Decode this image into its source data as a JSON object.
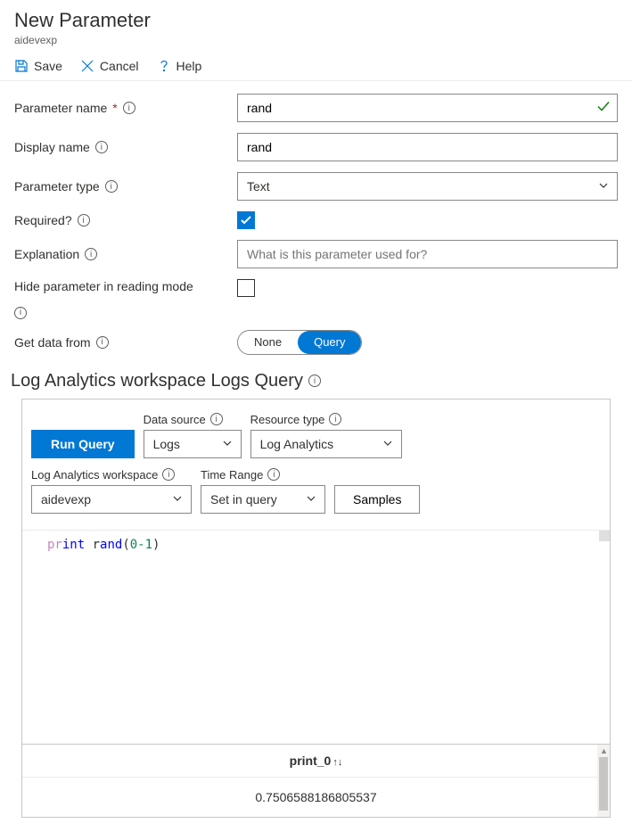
{
  "header": {
    "title": "New Parameter",
    "subtitle": "aidevexp"
  },
  "toolbar": {
    "save": "Save",
    "cancel": "Cancel",
    "help": "Help"
  },
  "form": {
    "param_name_label": "Parameter name",
    "param_name_value": "rand",
    "display_name_label": "Display name",
    "display_name_value": "rand",
    "param_type_label": "Parameter type",
    "param_type_value": "Text",
    "required_label": "Required?",
    "required_checked": true,
    "explanation_label": "Explanation",
    "explanation_placeholder": "What is this parameter used for?",
    "hide_label": "Hide parameter in reading mode",
    "get_data_label": "Get data from",
    "seg_none": "None",
    "seg_query": "Query"
  },
  "section": {
    "title": "Log Analytics workspace Logs Query"
  },
  "query": {
    "run": "Run Query",
    "data_source_label": "Data source",
    "data_source_value": "Logs",
    "resource_type_label": "Resource type",
    "resource_type_value": "Log Analytics",
    "workspace_label": "Log Analytics workspace",
    "workspace_value": "aidevexp",
    "time_range_label": "Time Range",
    "time_range_value": "Set in query",
    "samples": "Samples",
    "code_print": "pr",
    "code_int": "int",
    "code_r": " r",
    "code_and": "and",
    "code_paren_open": "(",
    "code_num": "0-1",
    "code_paren_close": ")"
  },
  "result": {
    "col": "print_0",
    "value": "0.7506588186805537"
  }
}
